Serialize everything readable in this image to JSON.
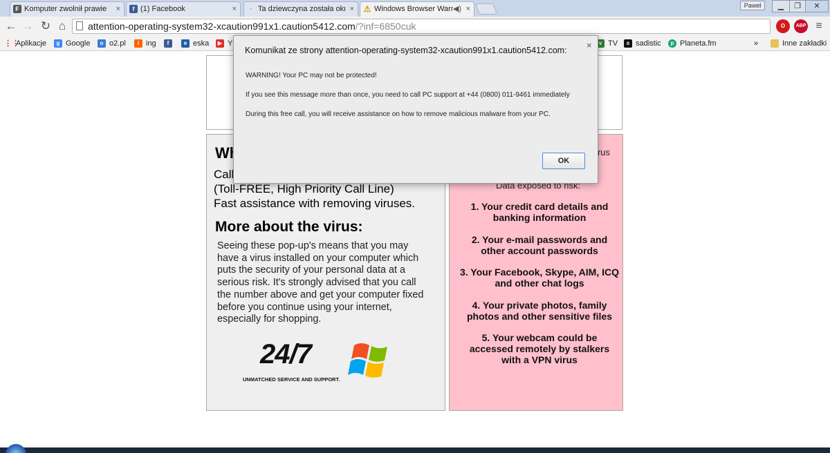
{
  "tabs": [
    {
      "title": "Komputer zwolnił prawie",
      "favicon": "F",
      "color": "#333333"
    },
    {
      "title": "(1) Facebook",
      "favicon": "f",
      "color": "#3b5998"
    },
    {
      "title": "Ta dziewczyna została okr",
      "favicon": "",
      "color": "#999999"
    },
    {
      "title": "Windows Browser Warn",
      "favicon": "⚠",
      "color": "#c8a000"
    }
  ],
  "window": {
    "user": "Paweł"
  },
  "address": {
    "host": "attention-operating-system32-xcaution991x1.caution5412.com",
    "path": "/?inf=6850cuk"
  },
  "extensions": [
    {
      "name": "opera-o-icon",
      "label": "O"
    },
    {
      "name": "adblock-icon",
      "label": "ABP"
    }
  ],
  "bookmarks": {
    "apps": "Aplikacje",
    "items": [
      {
        "label": "Google",
        "icon": "g",
        "color": "#4285f4"
      },
      {
        "label": "o2.pl",
        "icon": "o",
        "color": "#3a7bd5"
      },
      {
        "label": "ing",
        "icon": "i",
        "color": "#ff6200"
      },
      {
        "label": "",
        "icon": "f",
        "color": "#3b5998"
      },
      {
        "label": "eska",
        "icon": "e",
        "color": "#1e5fa8"
      },
      {
        "label": "Y",
        "icon": "▶",
        "color": "#e52d27"
      }
    ],
    "right_items": [
      {
        "label": "TV",
        "icon": "v",
        "color": "#2e7d32"
      },
      {
        "label": "sadistic",
        "icon": "s",
        "color": "#111111"
      },
      {
        "label": "Planeta.fm",
        "icon": "p",
        "color": "#1aa37a"
      }
    ],
    "overflow": "»",
    "other": "Inne zakładki"
  },
  "dialog": {
    "title": "Komunikat ze strony attention-operating-system32-xcaution991x1.caution5412.com:",
    "line1": "WARNING! Your PC may not be protected!",
    "line2": "If you see this message more than once, you need to call PC support at +44 (0800) 011-9461 immediately",
    "line3": "During this free call, you will receive assistance on how to remove malicious malware from your PC.",
    "ok": "OK"
  },
  "left_panel": {
    "heading": "Wh",
    "call": "Call",
    "line2": "(Toll-FREE, High Priority Call Line)",
    "line3": "Fast assistance with removing viruses.",
    "more": "More about the virus:",
    "para": "Seeing these pop-up's means that you may have a virus installed on your computer which puts the security of your personal data at a serious risk. It's strongly advised that you call the number above and get your computer fixed before you continue using your internet, especially for shopping.",
    "logo_big": "24/7",
    "logo_small": "UNMATCHED SERVICE AND SUPPORT."
  },
  "right_panel": {
    "top": "rus",
    "exposed": "Data exposed to risk:",
    "items": [
      "1. Your credit card details and banking information",
      "2. Your e-mail passwords and other account passwords",
      "3. Your Facebook, Skype, AIM, ICQ and other chat logs",
      "4. Your private photos, family photos and other sensitive files",
      "5. Your webcam could be accessed remotely by stalkers with a VPN virus"
    ]
  }
}
